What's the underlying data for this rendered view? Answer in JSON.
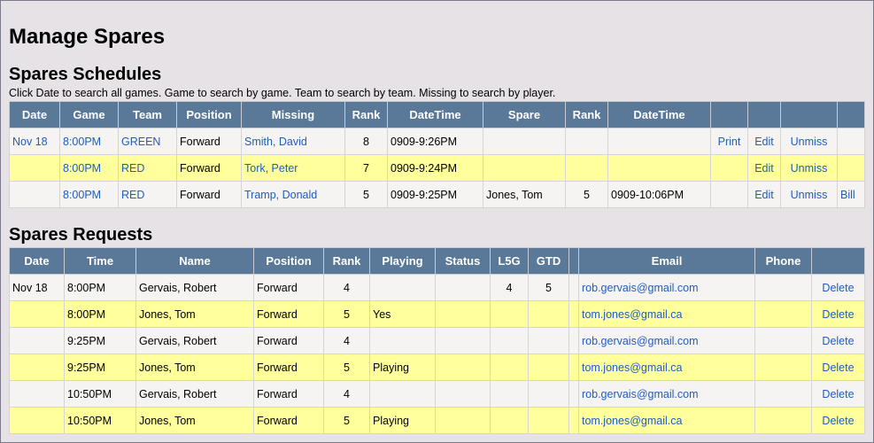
{
  "title": "Manage Spares",
  "schedules": {
    "heading": "Spares Schedules",
    "instructions": "Click Date to search all games. Game to search by game. Team to search by team. Missing to search by player.",
    "headers": [
      "Date",
      "Game",
      "Team",
      "Position",
      "Missing",
      "Rank",
      "DateTime",
      "Spare",
      "Rank",
      "DateTime",
      "",
      "",
      ""
    ],
    "rows": [
      {
        "date": "Nov 18",
        "game": "8:00PM",
        "team": "GREEN",
        "position": "Forward",
        "missing": "Smith, David",
        "rank": "8",
        "datetime": "0909-9:26PM",
        "spare": "",
        "spare_rank": "",
        "spare_datetime": "",
        "print": "Print",
        "edit": "Edit",
        "unmiss": "Unmiss",
        "bill": ""
      },
      {
        "date": "",
        "game": "8:00PM",
        "team": "RED",
        "position": "Forward",
        "missing": "Tork, Peter",
        "rank": "7",
        "datetime": "0909-9:24PM",
        "spare": "",
        "spare_rank": "",
        "spare_datetime": "",
        "print": "",
        "edit": "Edit",
        "unmiss": "Unmiss",
        "bill": ""
      },
      {
        "date": "",
        "game": "8:00PM",
        "team": "RED",
        "position": "Forward",
        "missing": "Tramp, Donald",
        "rank": "5",
        "datetime": "0909-9:25PM",
        "spare": "Jones, Tom",
        "spare_rank": "5",
        "spare_datetime": "0909-10:06PM",
        "print": "",
        "edit": "Edit",
        "unmiss": "Unmiss",
        "bill": "Bill"
      }
    ]
  },
  "requests": {
    "heading": "Spares Requests",
    "headers": [
      "Date",
      "Time",
      "Name",
      "Position",
      "Rank",
      "Playing",
      "Status",
      "L5G",
      "GTD",
      "",
      "Email",
      "Phone",
      ""
    ],
    "rows": [
      {
        "date": "Nov 18",
        "time": "8:00PM",
        "name": "Gervais, Robert",
        "position": "Forward",
        "rank": "4",
        "playing": "",
        "status": "",
        "l5g": "4",
        "gtd": "5",
        "email": "rob.gervais@gmail.com",
        "phone": "",
        "delete": "Delete"
      },
      {
        "date": "",
        "time": "8:00PM",
        "name": "Jones, Tom",
        "position": "Forward",
        "rank": "5",
        "playing": "Yes",
        "status": "",
        "l5g": "",
        "gtd": "",
        "email": "tom.jones@gmail.ca",
        "phone": "",
        "delete": "Delete"
      },
      {
        "date": "",
        "time": "9:25PM",
        "name": "Gervais, Robert",
        "position": "Forward",
        "rank": "4",
        "playing": "",
        "status": "",
        "l5g": "",
        "gtd": "",
        "email": "rob.gervais@gmail.com",
        "phone": "",
        "delete": "Delete"
      },
      {
        "date": "",
        "time": "9:25PM",
        "name": "Jones, Tom",
        "position": "Forward",
        "rank": "5",
        "playing": "Playing",
        "status": "",
        "l5g": "",
        "gtd": "",
        "email": "tom.jones@gmail.ca",
        "phone": "",
        "delete": "Delete"
      },
      {
        "date": "",
        "time": "10:50PM",
        "name": "Gervais, Robert",
        "position": "Forward",
        "rank": "4",
        "playing": "",
        "status": "",
        "l5g": "",
        "gtd": "",
        "email": "rob.gervais@gmail.com",
        "phone": "",
        "delete": "Delete"
      },
      {
        "date": "",
        "time": "10:50PM",
        "name": "Jones, Tom",
        "position": "Forward",
        "rank": "5",
        "playing": "Playing",
        "status": "",
        "l5g": "",
        "gtd": "",
        "email": "tom.jones@gmail.ca",
        "phone": "",
        "delete": "Delete"
      }
    ]
  },
  "colors": {
    "header_bg": "#5a7898",
    "row_white": "#f5f4f3",
    "row_yellow": "#ffff9c",
    "link": "#1f5dc0",
    "page_bg": "#e6e2e6"
  }
}
